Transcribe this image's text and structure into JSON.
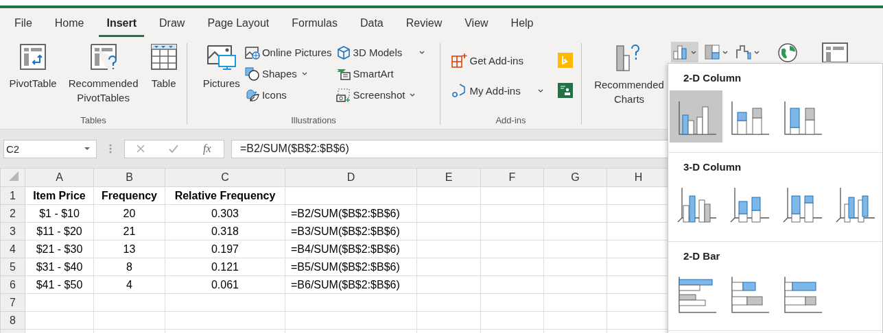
{
  "menu_tabs": [
    {
      "label": "File",
      "selected": false
    },
    {
      "label": "Home",
      "selected": false
    },
    {
      "label": "Insert",
      "selected": true
    },
    {
      "label": "Draw",
      "selected": false
    },
    {
      "label": "Page Layout",
      "selected": false
    },
    {
      "label": "Formulas",
      "selected": false
    },
    {
      "label": "Data",
      "selected": false
    },
    {
      "label": "Review",
      "selected": false
    },
    {
      "label": "View",
      "selected": false
    },
    {
      "label": "Help",
      "selected": false
    }
  ],
  "ribbon": {
    "tables": {
      "label": "Tables",
      "buttons": [
        "PivotTable",
        "Recommended PivotTables",
        "Table"
      ]
    },
    "illustrations": {
      "label": "Illustrations",
      "pictures": "Pictures",
      "items": [
        {
          "label": "Online Pictures",
          "dropdown": false
        },
        {
          "label": "Shapes",
          "dropdown": true
        },
        {
          "label": "Icons",
          "dropdown": false
        },
        {
          "label": "3D Models",
          "dropdown": true
        },
        {
          "label": "SmartArt",
          "dropdown": false
        },
        {
          "label": "Screenshot",
          "dropdown": true
        }
      ]
    },
    "addins": {
      "label": "Add-ins",
      "items": [
        {
          "label": "Get Add-ins",
          "dropdown": false
        },
        {
          "label": "My Add-ins",
          "dropdown": true
        }
      ]
    },
    "charts": {
      "recommended": "Recommended Charts"
    }
  },
  "formula_bar": {
    "name_box": "C2",
    "fx": "fx",
    "formula": "=B2/SUM($B$2:$B$6)"
  },
  "sheet": {
    "columns": [
      "A",
      "B",
      "C",
      "D",
      "E",
      "F",
      "G",
      "H"
    ],
    "header": {
      "number": "1",
      "cells": [
        "Item Price",
        "Frequency",
        "Relative Frequency"
      ]
    },
    "rows": [
      {
        "number": "2",
        "cells": [
          "$1 - $10",
          "20",
          "0.303",
          "=B2/SUM($B$2:$B$6)"
        ]
      },
      {
        "number": "3",
        "cells": [
          "$11 - $20",
          "21",
          "0.318",
          "=B3/SUM($B$2:$B$6)"
        ]
      },
      {
        "number": "4",
        "cells": [
          "$21 - $30",
          "13",
          "0.197",
          "=B4/SUM($B$2:$B$6)"
        ]
      },
      {
        "number": "5",
        "cells": [
          "$31 - $40",
          "8",
          "0.121",
          "=B5/SUM($B$2:$B$6)"
        ]
      },
      {
        "number": "6",
        "cells": [
          "$41 - $50",
          "4",
          "0.061",
          "=B6/SUM($B$2:$B$6)"
        ]
      },
      {
        "number": "7"
      },
      {
        "number": "8"
      }
    ]
  },
  "chart_menu": {
    "sections": [
      {
        "title": "2-D Column",
        "options": [
          {
            "selected": true
          },
          {
            "selected": false
          },
          {
            "selected": false
          }
        ]
      },
      {
        "title": "3-D Column",
        "options": [
          {
            "selected": false
          },
          {
            "selected": false
          },
          {
            "selected": false
          },
          {
            "selected": false
          }
        ]
      },
      {
        "title": "2-D Bar",
        "options": [
          {
            "selected": false
          },
          {
            "selected": false
          },
          {
            "selected": false
          }
        ]
      }
    ]
  }
}
